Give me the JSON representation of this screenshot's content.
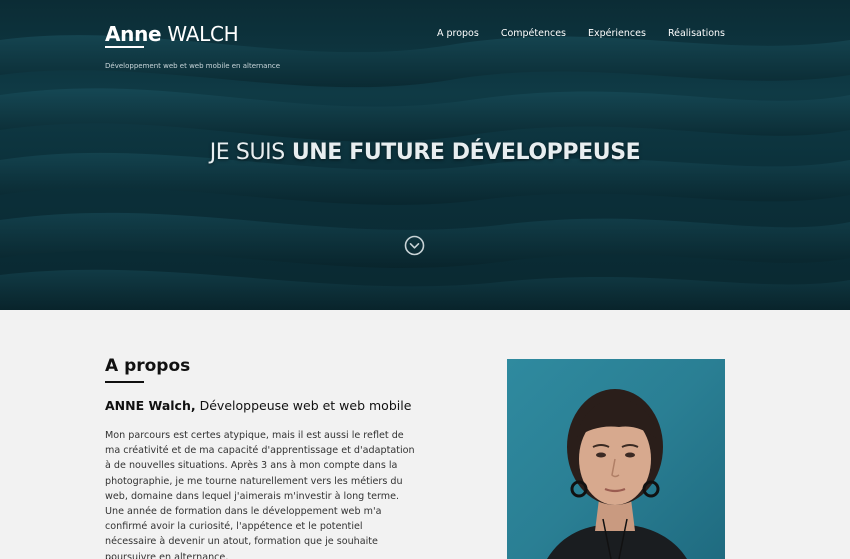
{
  "header": {
    "logo_first": "Anne",
    "logo_last": "WALCH",
    "tagline": "Développement web et web mobile en alternance",
    "nav": [
      {
        "label": "A propos"
      },
      {
        "label": "Compétences"
      },
      {
        "label": "Expériences"
      },
      {
        "label": "Réalisations"
      }
    ]
  },
  "hero": {
    "headline_light": "JE SUIS",
    "headline_strong": "UNE FUTURE DÉVELOPPEUSE",
    "scroll_icon": "chevron-down-circle-icon"
  },
  "about": {
    "title": "A propos",
    "subtitle_name": "ANNE Walch,",
    "subtitle_role": "Développeuse web et web mobile",
    "paragraph": "Mon parcours est certes atypique, mais il est aussi le reflet de ma créativité et de ma capacité d'apprentissage et d'adaptation à de nouvelles situations. Après 3 ans à mon compte dans la photographie, je me tourne naturellement vers les métiers du web, domaine dans lequel j'aimerais m'investir à long terme. Une année de formation dans le développement web m'a confirmé avoir la curiosité, l'appétence et le potentiel nécessaire à devenir un atout, formation que je souhaite poursuivre en alternance.",
    "more_text": "...",
    "photo": "portrait-photo"
  },
  "colors": {
    "hero_bg": "#0f3a45",
    "page_bg": "#f2f2f2",
    "photo_bg": "#2a7f94"
  }
}
